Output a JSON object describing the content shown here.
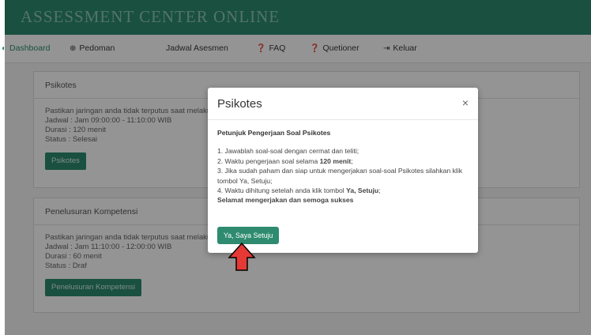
{
  "header": {
    "brand": "ASSESSMENT CENTER ONLINE"
  },
  "nav": [
    {
      "label": "Dashboard",
      "icon": "dashboard-icon"
    },
    {
      "label": "Pedoman",
      "icon": "globe-icon"
    },
    {
      "label": "Jadwal Asesmen",
      "icon": ""
    },
    {
      "label": "FAQ",
      "icon": "question-icon"
    },
    {
      "label": "Quetioner",
      "icon": "question-icon"
    },
    {
      "label": "Keluar",
      "icon": "logout-icon"
    }
  ],
  "panels": [
    {
      "title": "Psikotes",
      "notice": "Pastikan jaringan anda tidak terputus saat melakuk",
      "jadwal": "Jadwal : Jam 09:00:00 - 11:10:00 WIB",
      "durasi": "Durasi : 120 menit",
      "status": "Status : Selesai",
      "button": "Psikotes"
    },
    {
      "title": "Penelusuran Kompetensi",
      "notice": "Pastikan jaringan anda tidak terputus saat melakuk",
      "jadwal": "Jadwal : Jam 11:10:00 - 12:00:00 WIB",
      "durasi": "Durasi : 60 menit",
      "status": "Status : Draf",
      "button": "Penelusuran Kompetensi"
    }
  ],
  "modal": {
    "title": "Psikotes",
    "close": "×",
    "subtitle": "Petunjuk Pengerjaan Soal Psikotes",
    "line1": "1. Jawablah soal-soal dengan cermat dan teliti;",
    "line2_pre": "2. Waktu pengerjaan soal selama ",
    "line2_bold": "120 menit",
    "line2_post": ";",
    "line3": "3. Jika sudah paham dan siap untuk mengerjakan soal-soal Psikotes silahkan klik tombol Ya, Setuju;",
    "line4_pre": "4. Waktu dihitung setelah anda klik tombol ",
    "line4_bold": "Ya, Setuju",
    "line4_post": ";",
    "closing": "Selamat mengerjakan dan semoga sukses",
    "button": "Ya, Saya Setuju"
  },
  "colors": {
    "brand": "#2e8b6f",
    "arrow": "#e53935"
  }
}
